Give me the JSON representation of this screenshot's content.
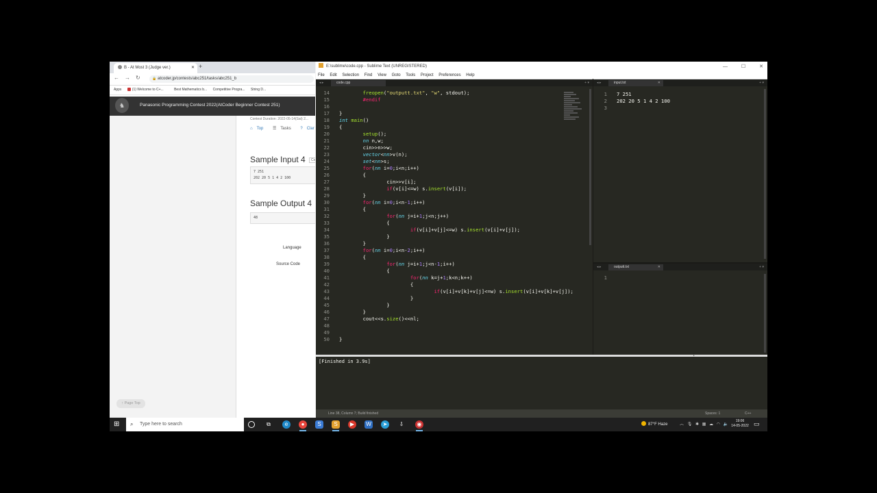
{
  "browser": {
    "tab_title": "B - At Most 3 (Judge ver.)",
    "url": "atcoder.jp/contests/abc251/tasks/abc251_b",
    "bookmarks": [
      "Apps",
      "(1) Welcome to C+...",
      "Best Mathematics b...",
      "Competitive Progra...",
      "String D..."
    ]
  },
  "atcoder": {
    "contest_title": "Panasonic Programming Contest 2022(AtCoder Beginner Contest 251)",
    "duration": "Contest Duration: 2022-05-14(Sat) 2...",
    "tabs": [
      "Top",
      "Tasks",
      "Clar"
    ],
    "sample_input_heading": "Sample Input 4",
    "sample_input": "7 251\n202 20 5 1 4 2 100",
    "copy_label": "Co",
    "sample_output_heading": "Sample Output 4",
    "sample_output": "48",
    "language_label": "Language",
    "source_code_label": "Source Code",
    "page_top": "Page Top"
  },
  "sublime": {
    "title": "E:\\sublime\\code.cpp - Sublime Text (UNREGISTERED)",
    "menu": [
      "File",
      "Edit",
      "Selection",
      "Find",
      "View",
      "Goto",
      "Tools",
      "Project",
      "Preferences",
      "Help"
    ],
    "main_tab": "code.cpp",
    "input_tab": "input.txt",
    "output_tab": "outputt.txt",
    "code_lines": [
      {
        "n": "14",
        "t": "        freopen(\"outputt.txt\", \"w\", stdout);"
      },
      {
        "n": "15",
        "t": "        #endif"
      },
      {
        "n": "16",
        "t": ""
      },
      {
        "n": "17",
        "t": "}"
      },
      {
        "n": "18",
        "t": "int main()"
      },
      {
        "n": "19",
        "t": "{"
      },
      {
        "n": "20",
        "t": "        setup();"
      },
      {
        "n": "21",
        "t": "        nn n,w;"
      },
      {
        "n": "22",
        "t": "        cin>>n>>w;"
      },
      {
        "n": "23",
        "t": "        vector<nn>v(n);"
      },
      {
        "n": "24",
        "t": "        set<nn>s;"
      },
      {
        "n": "25",
        "t": "        for(nn i=0;i<n;i++)"
      },
      {
        "n": "26",
        "t": "        {"
      },
      {
        "n": "27",
        "t": "                cin>>v[i];"
      },
      {
        "n": "28",
        "t": "                if(v[i]<=w) s.insert(v[i]);"
      },
      {
        "n": "29",
        "t": "        }"
      },
      {
        "n": "30",
        "t": "        for(nn i=0;i<n-1;i++)"
      },
      {
        "n": "31",
        "t": "        {"
      },
      {
        "n": "32",
        "t": "                for(nn j=i+1;j<n;j++)"
      },
      {
        "n": "33",
        "t": "                {"
      },
      {
        "n": "34",
        "t": "                        if(v[i]+v[j]<=w) s.insert(v[i]+v[j]);"
      },
      {
        "n": "35",
        "t": "                }"
      },
      {
        "n": "36",
        "t": "        }"
      },
      {
        "n": "37",
        "t": "        for(nn i=0;i<n-2;i++)"
      },
      {
        "n": "38",
        "t": "        {"
      },
      {
        "n": "39",
        "t": "                for(nn j=i+1;j<n-1;i++)"
      },
      {
        "n": "40",
        "t": "                {"
      },
      {
        "n": "41",
        "t": "                        for(nn k=j+1;k<n;k++)"
      },
      {
        "n": "42",
        "t": "                        {"
      },
      {
        "n": "43",
        "t": "                                if(v[i]+v[k]+v[j]<=w) s.insert(v[i]+v[k]+v[j]);"
      },
      {
        "n": "44",
        "t": "                        }"
      },
      {
        "n": "45",
        "t": "                }"
      },
      {
        "n": "46",
        "t": "        }"
      },
      {
        "n": "47",
        "t": "        cout<<s.size()<<nl;"
      },
      {
        "n": "48",
        "t": ""
      },
      {
        "n": "49",
        "t": ""
      },
      {
        "n": "50",
        "t": "}"
      }
    ],
    "input_lines": [
      {
        "n": "1",
        "t": "7 251"
      },
      {
        "n": "2",
        "t": "202 20 5 1 4 2 100"
      },
      {
        "n": "3",
        "t": ""
      }
    ],
    "output_lines": [
      {
        "n": "1",
        "t": ""
      }
    ],
    "console": "[Finished in 3.9s]",
    "status_left": "Line 38, Column 7; Build finished",
    "status_spaces": "Spaces: 1",
    "status_syntax": "C++"
  },
  "taskbar": {
    "search_placeholder": "Type here to search",
    "weather": "87°F  Haze",
    "time": "19:06",
    "date": "14-05-2022"
  }
}
